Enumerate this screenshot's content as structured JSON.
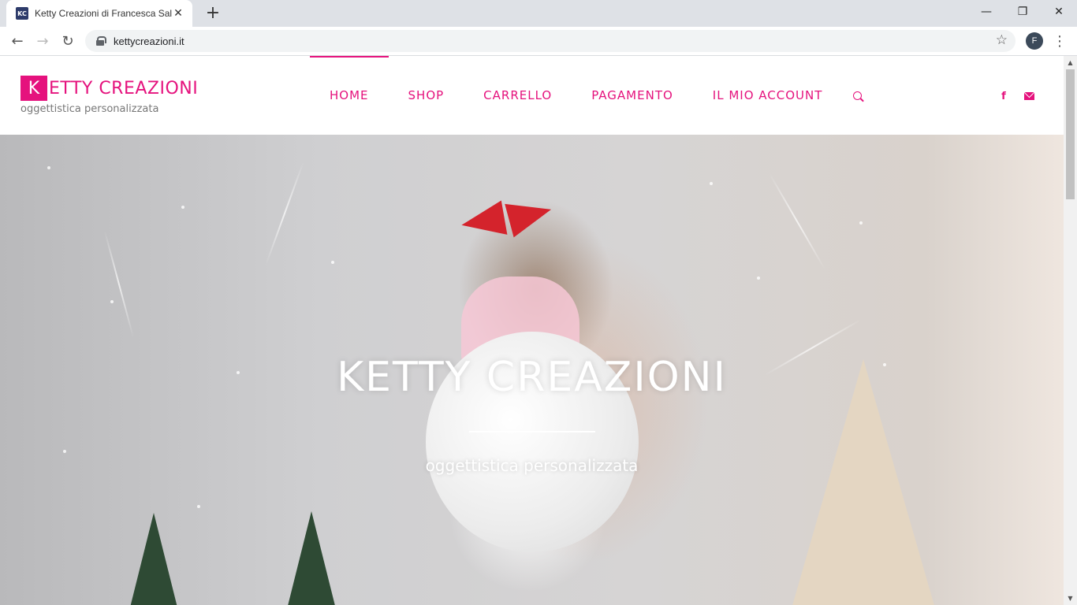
{
  "browser": {
    "tab_title": "Ketty Creazioni di Francesca Sale",
    "tab_favicon_text": "KC",
    "new_tab": "+",
    "url": "kettycreazioni.it",
    "profile_initial": "F"
  },
  "site": {
    "logo_letter": "K",
    "logo_rest": "ETTY CREAZIONI",
    "tagline": "oggettistica personalizzata",
    "accent_color": "#e5127d",
    "nav": [
      {
        "label": "HOME",
        "active": true
      },
      {
        "label": "SHOP"
      },
      {
        "label": "CARRELLO"
      },
      {
        "label": "PAGAMENTO"
      },
      {
        "label": "IL MIO ACCOUNT"
      }
    ],
    "social": {
      "facebook": "f"
    }
  },
  "hero": {
    "title": "KETTY CREAZIONI",
    "subtitle": "oggettistica personalizzata"
  }
}
